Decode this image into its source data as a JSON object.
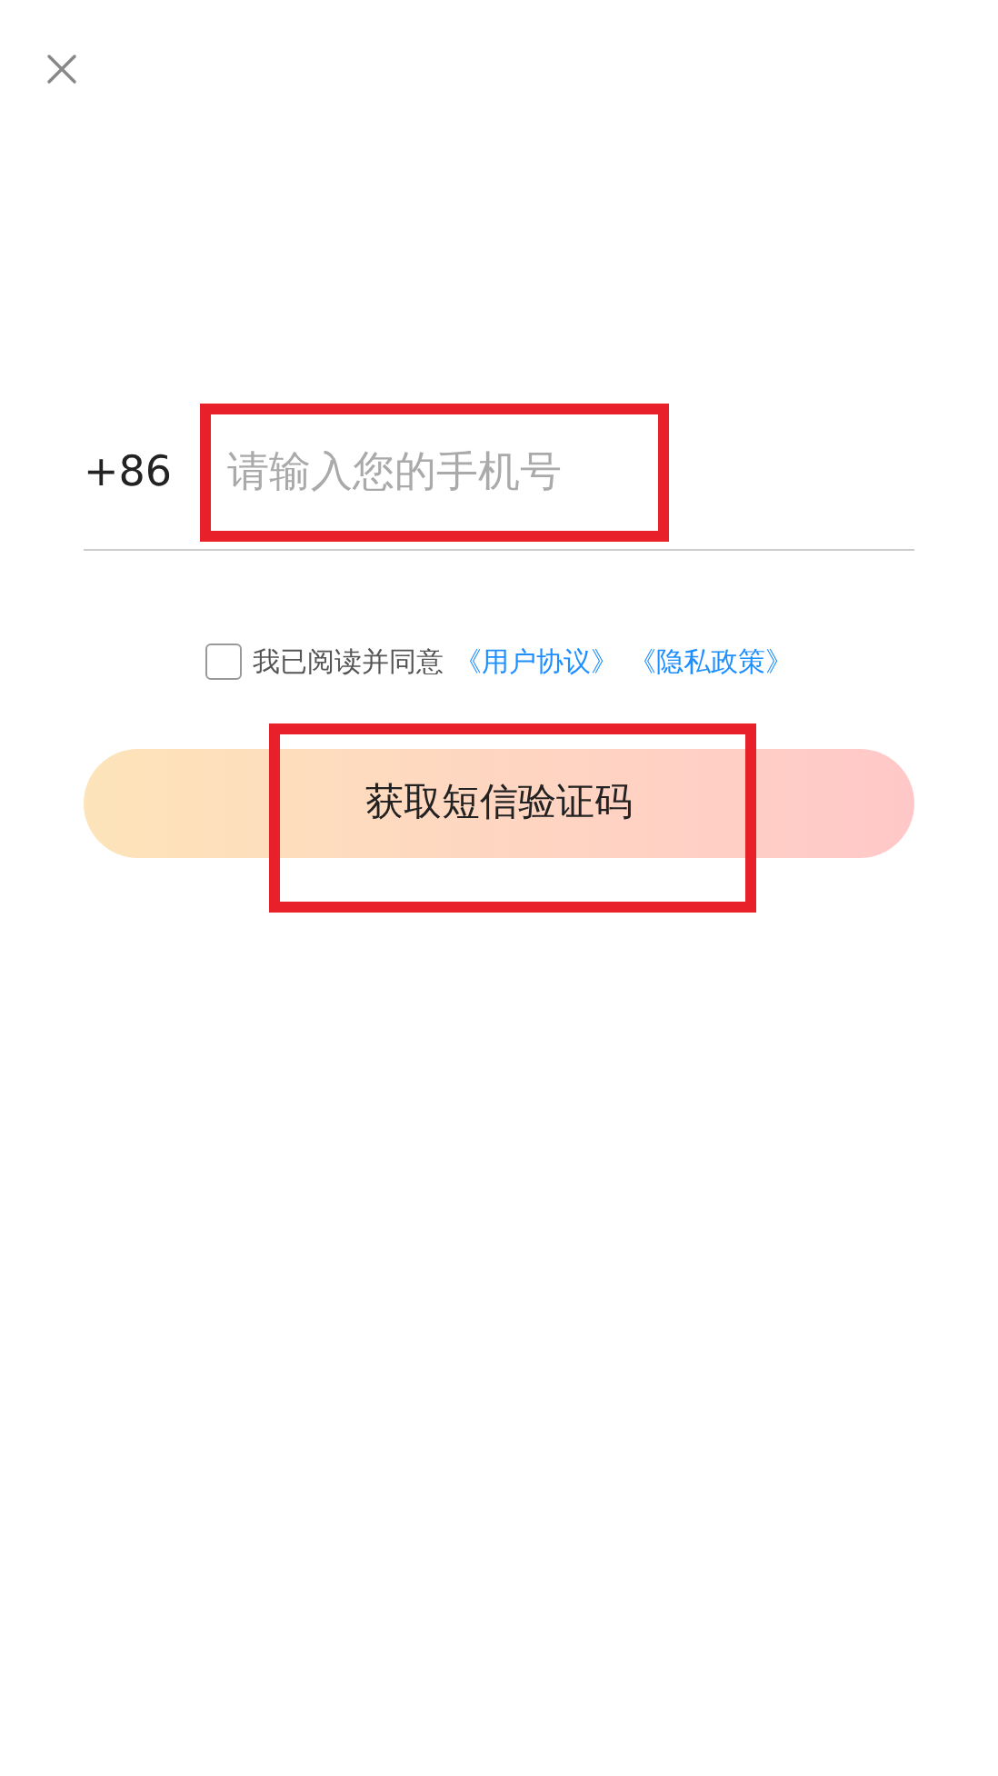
{
  "phone": {
    "country_code": "+86",
    "placeholder": "请输入您的手机号",
    "highlighted": true
  },
  "agreement": {
    "checked": false,
    "text": "我已阅读并同意",
    "links": [
      "《用户协议》",
      "《隐私政策》"
    ]
  },
  "submit": {
    "label": "获取短信验证码",
    "highlighted": true
  }
}
